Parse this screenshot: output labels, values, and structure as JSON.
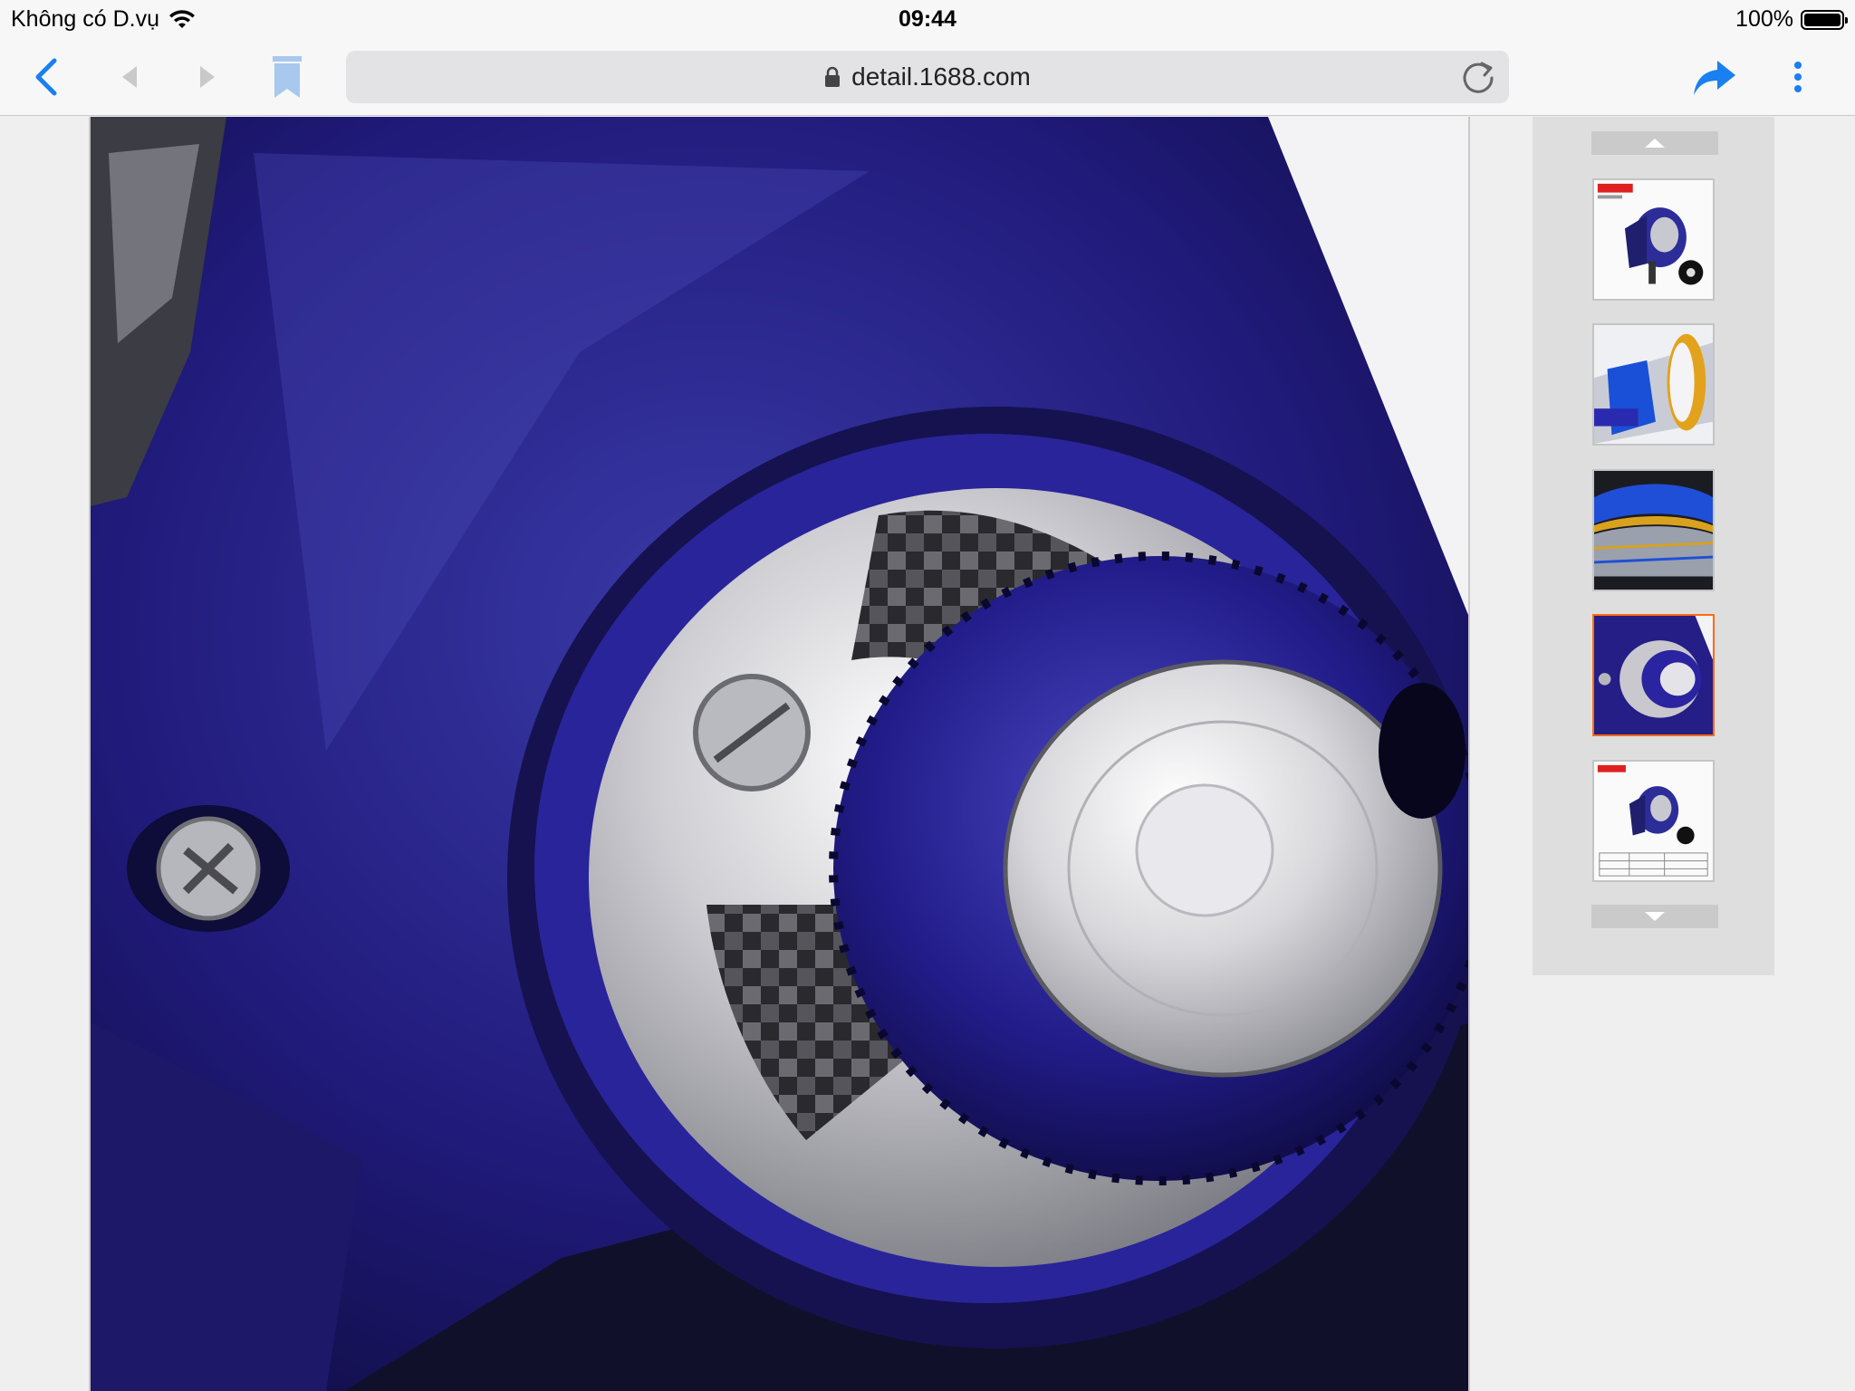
{
  "status": {
    "carrier": "Không có D.vụ",
    "time": "09:44",
    "battery": "100%",
    "battery_level": 1.0
  },
  "toolbar": {
    "url": "detail.1688.com",
    "icons": [
      "back-icon",
      "history-back-icon",
      "history-forward-icon",
      "bookmark-icon",
      "lock-icon",
      "reload-icon",
      "share-icon",
      "more-icon"
    ],
    "accent": "#1a7ff0"
  },
  "gallery": {
    "selected_index": 3,
    "active_border": "#ff6a13",
    "thumbnails": [
      {
        "badge": "#e02020"
      },
      {},
      {},
      {},
      {
        "badge": "#e02020"
      }
    ]
  }
}
